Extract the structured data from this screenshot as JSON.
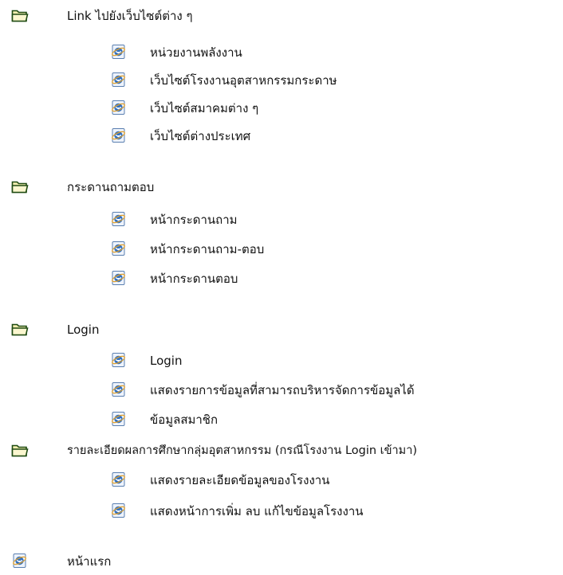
{
  "tree": {
    "groups": [
      {
        "label": "Link ไปยังเว็บไซต์ต่าง ๆ",
        "icon": "folder-icon",
        "items": [
          {
            "label": "หน่วยงานพลังงาน",
            "icon": "ie-page-icon"
          },
          {
            "label": "เว็บไซต์โรงงานอุตสาหกรรมกระดาษ",
            "icon": "ie-page-icon"
          },
          {
            "label": "เว็บไซต์สมาคมต่าง ๆ",
            "icon": "ie-page-icon"
          },
          {
            "label": "เว็บไซต์ต่างประเทศ",
            "icon": "ie-page-icon"
          }
        ]
      },
      {
        "label": "กระดานถามตอบ",
        "icon": "folder-icon",
        "items": [
          {
            "label": "หน้ากระดานถาม",
            "icon": "ie-page-icon"
          },
          {
            "label": "หน้ากระดานถาม-ตอบ",
            "icon": "ie-page-icon"
          },
          {
            "label": "หน้ากระดานตอบ",
            "icon": "ie-page-icon"
          }
        ]
      },
      {
        "label": "Login",
        "icon": "folder-icon",
        "items": [
          {
            "label": "Login",
            "icon": "ie-page-icon"
          },
          {
            "label": "แสดงรายการข้อมูลที่สามารถบริหารจัดการข้อมูลได้",
            "icon": "ie-page-icon"
          },
          {
            "label": "ข้อมูลสมาชิก",
            "icon": "ie-page-icon"
          }
        ]
      },
      {
        "label": "รายละเอียดผลการศึกษากลุ่มอุตสาหกรรม (กรณีโรงงาน Login เข้ามา)",
        "icon": "folder-icon",
        "items": [
          {
            "label": "แสดงรายละเอียดข้อมูลของโรงงาน",
            "icon": "ie-page-icon"
          },
          {
            "label": "แสดงหน้าการเพิ่ม ลบ แก้ไขข้อมูลโรงงาน",
            "icon": "ie-page-icon"
          }
        ]
      }
    ],
    "root_item": {
      "label": "หน้าแรก",
      "icon": "ie-page-icon"
    }
  },
  "colors": {
    "folder_fill": "#f3eeb0",
    "folder_stroke": "#1f4b12",
    "ie_blue": "#2f6fc0",
    "ie_ring": "#e2a02a"
  }
}
